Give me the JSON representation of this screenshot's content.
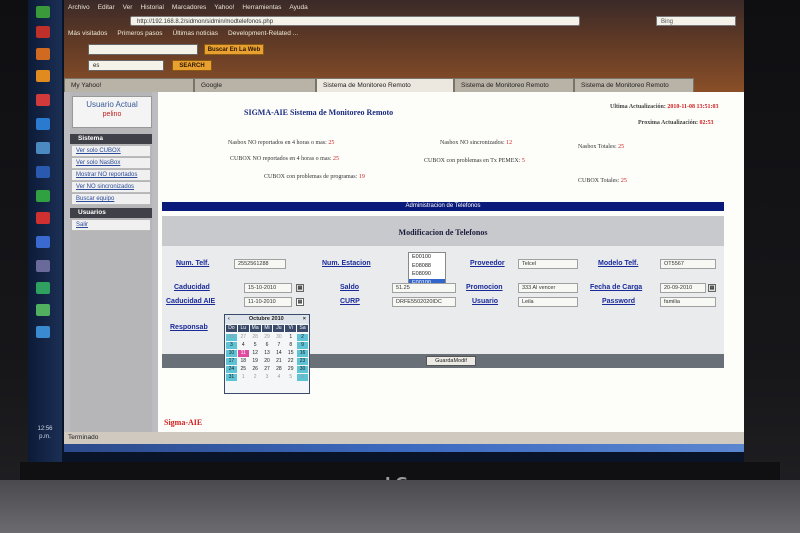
{
  "browser": {
    "menu": [
      "Archivo",
      "Editar",
      "Ver",
      "Historial",
      "Marcadores",
      "Yahoo!",
      "Herramientas",
      "Ayuda"
    ],
    "url": "http://192.168.8.2/sidmon/sidmin/modtelefonos.php",
    "search_placeholder": "Bing",
    "bookmarks": [
      "Más visitados",
      "Primeros pasos",
      "Últimas noticias",
      "Development-Related ..."
    ],
    "toolbar_input": "",
    "toolbar_btn1": "Buscar En La Web",
    "toolbar_input2": "es",
    "toolbar_btn2": "SEARCH",
    "tabs": [
      {
        "label": "My Yahoo!",
        "active": false
      },
      {
        "label": "Google",
        "active": false
      },
      {
        "label": "Sistema de Monitoreo Remoto",
        "active": true
      },
      {
        "label": "Sistema de Monitoreo Remoto",
        "active": false
      },
      {
        "label": "Sistema de Monitoreo Remoto",
        "active": false
      }
    ],
    "status": "Terminado"
  },
  "sidebar": {
    "user_title": "Usuario Actual",
    "user_name": "pelino",
    "section1": "Sistema",
    "items1": [
      "Ver solo CUBOX",
      "Ver solo NasBox",
      "Mostrar NO reportados",
      "Ver NO sincronizados",
      "Buscar equipo"
    ],
    "section2": "Usuarios",
    "items2": [
      "Salir"
    ]
  },
  "header": {
    "brand": "SIGMA-AIE Sistema de Monitoreo Remoto",
    "last_update_label": "Ultima Actualización:",
    "last_update_value": "2010-11-08 13:51:03",
    "next_update_label": "Proxima Actualización:",
    "next_update_value": "02:53"
  },
  "stats": {
    "s1_label": "Nasbox NO reportados en 4 horas o mas:",
    "s1_value": "25",
    "s2_label": "Nasbox NO sincronizados:",
    "s2_value": "12",
    "s3_label": "Nasbox Totales:",
    "s3_value": "25",
    "s4_label": "CUBOX NO reportados en 4 horas o mas:",
    "s4_value": "25",
    "s5_label": "CUBOX con problemas en Tx PEMEX:",
    "s5_value": "5",
    "s6_label": "CUBOX con problemas de programas:",
    "s6_value": "19",
    "s7_label": "CUBOX Totales:",
    "s7_value": "25"
  },
  "admin_bar": "Administracion de Telefonos",
  "form": {
    "title": "Modificacion de Telefonos",
    "num_telf_label": "Num. Telf.",
    "num_telf_value": "2552561288",
    "num_estacion_label": "Num. Estacion",
    "estaciones": [
      "E00100",
      "E08088",
      "E08090",
      "E00100"
    ],
    "proveedor_label": "Proveedor",
    "proveedor_value": "Telcel",
    "modelo_label": "Modelo Telf.",
    "modelo_value": "OT5567",
    "caducidad_label": "Caducidad",
    "caducidad_value": "15-10-2010",
    "saldo_label": "Saldo",
    "saldo_value": "51.25",
    "promocion_label": "Promocion",
    "promocion_value": "333 Al vencer",
    "fecha_carga_label": "Fecha de Carga",
    "fecha_carga_value": "20-09-2010",
    "caducidad_aie_label": "Caducidad AIE",
    "caducidad_aie_value": "11-10-2010",
    "curp_label": "CURP",
    "curp_value": "DRFE5502020IDC",
    "usuario_label": "Usuario",
    "usuario_value": "Leila",
    "password_label": "Password",
    "password_value": "familia",
    "responsable_label": "Responsab",
    "save_label": "GuardaModif"
  },
  "calendar": {
    "month": "Octubre 2010",
    "days": [
      "Do",
      "Lu",
      "Ma",
      "Mi",
      "Ju",
      "Vi",
      "Sa"
    ],
    "weeks": [
      [
        "26",
        "27",
        "28",
        "29",
        "30",
        "1",
        "2"
      ],
      [
        "3",
        "4",
        "5",
        "6",
        "7",
        "8",
        "9"
      ],
      [
        "10",
        "11",
        "12",
        "13",
        "14",
        "15",
        "16"
      ],
      [
        "17",
        "18",
        "19",
        "20",
        "21",
        "22",
        "23"
      ],
      [
        "24",
        "25",
        "26",
        "27",
        "28",
        "29",
        "30"
      ],
      [
        "31",
        "1",
        "2",
        "3",
        "4",
        "5",
        "6"
      ]
    ],
    "today": "11"
  },
  "footer": "Sigma-AIE"
}
